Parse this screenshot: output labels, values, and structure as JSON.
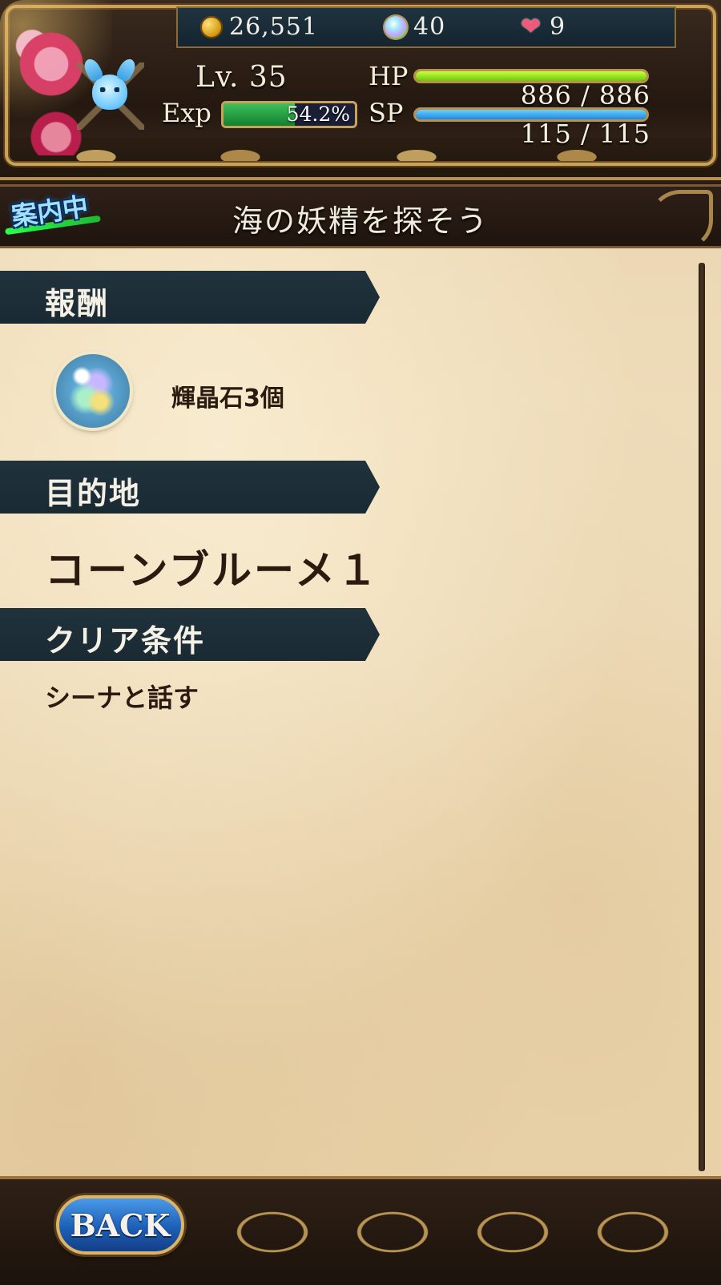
{
  "hud": {
    "coins": "26,551",
    "gems": "40",
    "hearts": "9",
    "level": "Lv. 35",
    "exp_label": "Exp",
    "exp_text": "54.2%",
    "exp_fraction": 0.542,
    "hp_label": "HP",
    "hp_value": "886 / 886",
    "hp_fraction": 1.0,
    "sp_label": "SP",
    "sp_value": "115 / 115",
    "sp_fraction": 1.0
  },
  "quest_banner": {
    "tag": "案内中",
    "title": "海の妖精を探そう"
  },
  "sections": {
    "reward": {
      "header": "報酬",
      "item_icon": "rainbow-crystal-orb-icon",
      "item_text": "輝晶石3個"
    },
    "destination": {
      "header": "目的地",
      "value": "コーンブルーメ１"
    },
    "clear_condition": {
      "header": "クリア条件",
      "value": "シーナと話す"
    }
  },
  "footer": {
    "back_label": "BACK"
  },
  "colors": {
    "hp_bar": "#8de020",
    "sp_bar": "#2e9cf0",
    "exp_bar": "#2aa048",
    "section_header_bg": "#1e2f38",
    "parchment": "#eedcb8",
    "gold_frame": "#c9a25a"
  }
}
